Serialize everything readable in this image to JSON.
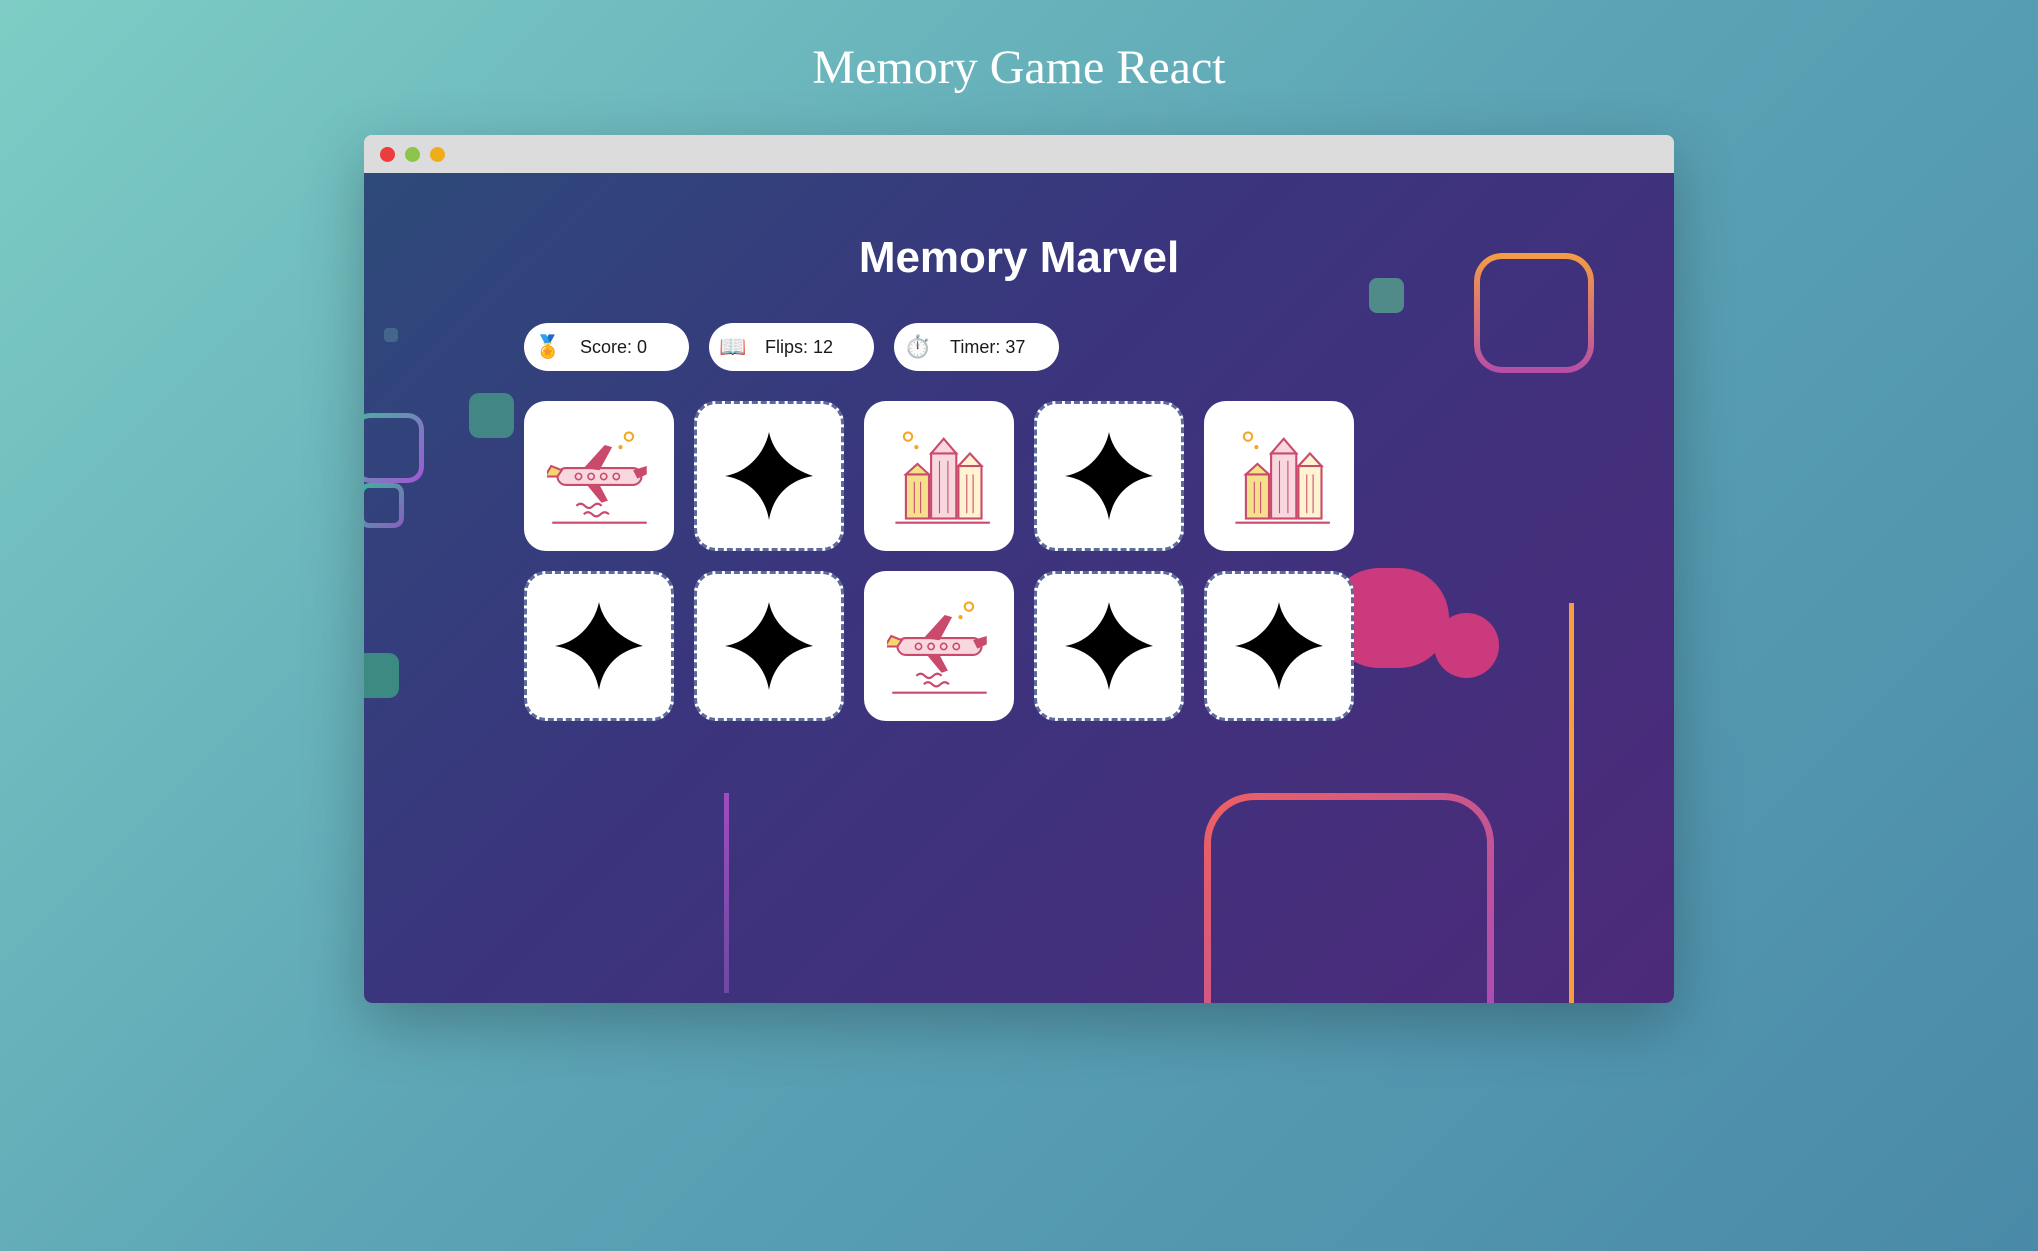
{
  "page_title": "Memory Game React",
  "game_title": "Memory Marvel",
  "stats": {
    "score": {
      "label": "Score: 0",
      "icon": "medal"
    },
    "flips": {
      "label": "Flips: 12",
      "icon": "book"
    },
    "timer": {
      "label": "Timer: 37",
      "icon": "stopwatch"
    }
  },
  "cards": [
    {
      "face": "airplane",
      "flipped": true
    },
    {
      "face": "back",
      "flipped": false
    },
    {
      "face": "buildings",
      "flipped": true
    },
    {
      "face": "back",
      "flipped": false
    },
    {
      "face": "buildings",
      "flipped": true
    },
    {
      "face": "back",
      "flipped": false
    },
    {
      "face": "back",
      "flipped": false
    },
    {
      "face": "airplane",
      "flipped": true
    },
    {
      "face": "back",
      "flipped": false
    },
    {
      "face": "back",
      "flipped": false
    }
  ],
  "colors": {
    "accent": "#6b7aa8",
    "card_bg": "#ffffff",
    "pink": "#cb3a7c",
    "orange": "#f59e42"
  }
}
